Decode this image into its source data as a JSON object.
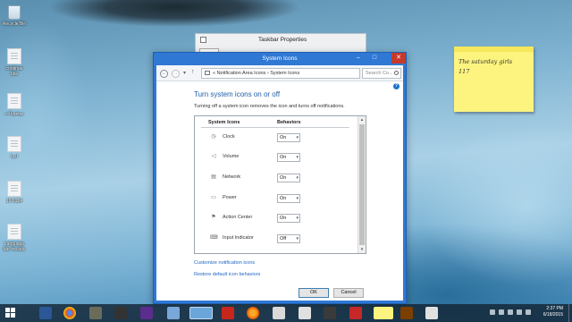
{
  "desktop": {
    "icons": [
      {
        "label": "Recycle Bin"
      },
      {
        "label": "continue bbe"
      },
      {
        "label": "موضوعات"
      },
      {
        "label": "ادبيا"
      },
      {
        "label": "19 6124"
      },
      {
        "label": "Language bar mosaic"
      }
    ]
  },
  "sticky_note": {
    "line1": "The saturday girls",
    "line2": "117"
  },
  "background_window": {
    "title": "Taskbar Properties"
  },
  "window": {
    "title": "System Icons",
    "address": {
      "crumbs": "« Notification Area Icons › System Icons",
      "search_placeholder": "Search Co..."
    },
    "heading": "Turn system icons on or off",
    "description": "Turning off a system icon removes the icon and turns off notifications.",
    "columns": {
      "icons": "System Icons",
      "behaviors": "Behaviors"
    },
    "rows": [
      {
        "label": "Clock",
        "value": "On",
        "icon": "clock-icon"
      },
      {
        "label": "Volume",
        "value": "On",
        "icon": "volume-icon"
      },
      {
        "label": "Network",
        "value": "On",
        "icon": "network-icon"
      },
      {
        "label": "Power",
        "value": "On",
        "icon": "power-icon"
      },
      {
        "label": "Action Center",
        "value": "On",
        "icon": "flag-icon"
      },
      {
        "label": "Input Indicator",
        "value": "Off",
        "icon": "keyboard-icon"
      }
    ],
    "links": {
      "customize": "Customize notification icons",
      "restore": "Restore default icon behaviors"
    },
    "buttons": {
      "ok": "OK",
      "cancel": "Cancel"
    }
  },
  "taskbar": {
    "time": "2:37 PM",
    "date": "6/18/2015"
  },
  "colors": {
    "titlebar": "#2f78d4",
    "close_button": "#c7392b",
    "link": "#1f66c2",
    "heading": "#1f5ea8",
    "sticky": "#fdf47f"
  }
}
